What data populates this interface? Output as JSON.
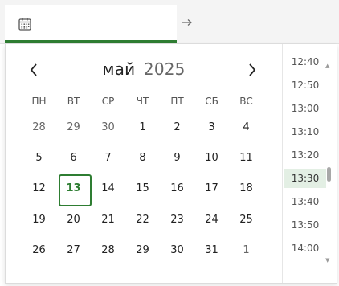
{
  "calendar": {
    "month": "май",
    "year": "2025",
    "weekdays": [
      "ПН",
      "ВТ",
      "СР",
      "ЧТ",
      "ПТ",
      "СБ",
      "ВС"
    ],
    "weeks": [
      [
        "28",
        "29",
        "30",
        "1",
        "2",
        "3",
        "4"
      ],
      [
        "5",
        "6",
        "7",
        "8",
        "9",
        "10",
        "11"
      ],
      [
        "12",
        "13",
        "14",
        "15",
        "16",
        "17",
        "18"
      ],
      [
        "19",
        "20",
        "21",
        "22",
        "23",
        "24",
        "25"
      ],
      [
        "26",
        "27",
        "28",
        "29",
        "30",
        "31",
        "1"
      ]
    ],
    "selected_day": "13"
  },
  "times": [
    "12:40",
    "12:50",
    "13:00",
    "13:10",
    "13:20",
    "13:30",
    "13:40",
    "13:50",
    "14:00"
  ],
  "selected_time": "13:30",
  "colors": {
    "accent": "#2e7d32",
    "time_highlight": "#e3efe4"
  },
  "icons": {
    "date": "calendar-icon",
    "range": "arrow-right-icon",
    "prev": "chevron-left-icon",
    "next": "chevron-right-icon"
  }
}
